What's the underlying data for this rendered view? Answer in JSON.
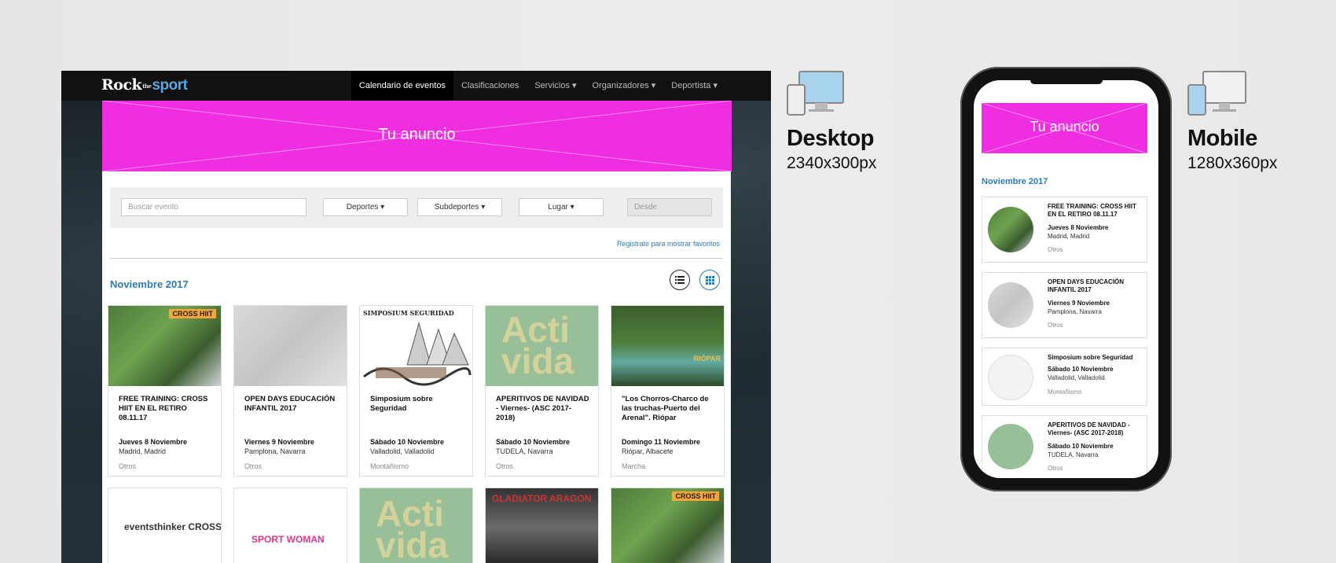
{
  "desktop": {
    "logo": {
      "rock": "Rock",
      "the": "the",
      "sport": "sport"
    },
    "nav": [
      {
        "label": "Calendario de eventos"
      },
      {
        "label": "Clasificaciones"
      },
      {
        "label": "Servicios ▾"
      },
      {
        "label": "Organizadores ▾"
      },
      {
        "label": "Deportista ▾"
      }
    ],
    "ad_text": "Tu  anuncio",
    "filters": {
      "search_placeholder": "Buscar evento",
      "deportes": "Deportes ▾",
      "subdeportes": "Subdeportes ▾",
      "lugar": "Lugar ▾",
      "desde_placeholder": "Desde"
    },
    "register_link": "Registrate para mostrar favoritos",
    "month": "Noviembre 2017",
    "cards": [
      {
        "title": "FREE TRAINING: CROSS HIIT EN EL RETIRO 08.11.17",
        "date": "Jueves 8 Noviembre",
        "place": "Madrid, Madrid",
        "category": "Otros",
        "badge": "CROSS HIIT"
      },
      {
        "title": "OPEN DAYS EDUCACIÓN INFANTIL 2017",
        "date": "Viernes 9 Noviembre",
        "place": "Pamplona, Navarra",
        "category": "Otros"
      },
      {
        "title": "Simposium sobre Seguridad",
        "date": "Sábado 10 Noviembre",
        "place": "Valladolid, Valladolid",
        "category": "Montañismo",
        "badge": "SIMPOSIUM SEGURIDAD"
      },
      {
        "title": "APERITIVOS DE NAVIDAD - Viernes- (ASC 2017-2018)",
        "date": "Sábado 10 Noviembre",
        "place": "TUDELA, Navarra",
        "category": "Otros",
        "badge": "Acti vida"
      },
      {
        "title": "\"Los Chorros-Charco de las truchas-Puerto del Arenal\". Riópar",
        "date": "Domingo 11 Noviembre",
        "place": "Riópar, Albacete",
        "category": "Marcha",
        "badge": "RIÓPAR"
      }
    ],
    "row2_badges": [
      "eventsthinker CROSS",
      "SPORT WOMAN",
      "Acti vida",
      "GLADIATOR ARAGON",
      "CROSS HIIT"
    ]
  },
  "captions": {
    "desktop_title": "Desktop",
    "desktop_size": "2340x300px",
    "mobile_title": "Mobile",
    "mobile_size": "1280x360px"
  },
  "mobile": {
    "ad_text": "Tu anuncio",
    "month": "Noviembre 2017",
    "cards": [
      {
        "title": "FREE TRAINING: CROSS HIIT EN EL RETIRO 08.11.17",
        "date": "Jueves 8 Noviembre",
        "place": "Madrid, Madrid",
        "category": "Otros"
      },
      {
        "title": "OPEN DAYS EDUCACIÓN INFANTIL 2017",
        "date": "Viernes 9 Noviembre",
        "place": "Pamplona, Navarra",
        "category": "Otros"
      },
      {
        "title": "Simposium sobre Seguridad",
        "date": "Sábado 10 Noviembre",
        "place": "Valladolid, Valladolid",
        "category": "Montañismo"
      },
      {
        "title": "APERITIVOS DE NAVIDAD - Viernes- (ASC 2017-2018)",
        "date": "Sábado 10 Noviembre",
        "place": "TUDELA, Navarra",
        "category": "Otros"
      }
    ]
  },
  "colors": {
    "accent": "#2a7ab8",
    "ad_magenta": "#ee2ee0"
  }
}
